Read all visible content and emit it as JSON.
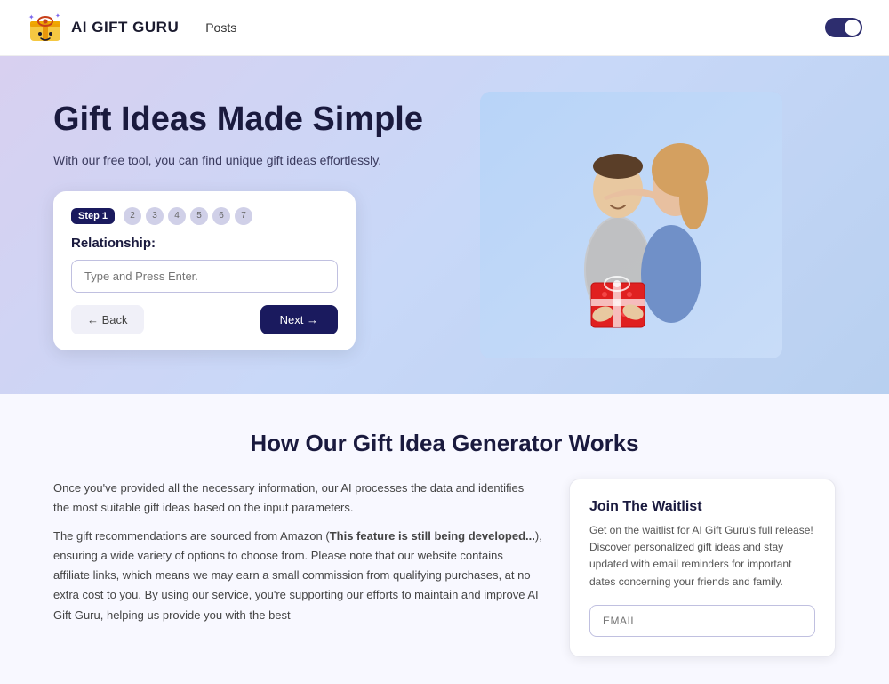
{
  "nav": {
    "logo_text": "AI GIFT GURU",
    "links": [
      {
        "label": "Posts"
      }
    ],
    "toggle_state": "dark"
  },
  "hero": {
    "title": "Gift Ideas Made Simple",
    "subtitle": "With our free tool, you can find unique gift ideas effortlessly.",
    "card": {
      "step_badge": "Step 1",
      "step_numbers": [
        2,
        3,
        4,
        5,
        6,
        7
      ],
      "relationship_label": "Relationship:",
      "input_placeholder": "Type and Press Enter.",
      "btn_back": "← Back",
      "btn_next": "Next →"
    }
  },
  "how_section": {
    "title": "How Our Gift Idea Generator Works",
    "paragraph1": "Once you've provided all the necessary information, our AI processes the data and identifies the most suitable gift ideas based on the input parameters.",
    "paragraph2_start": "The gift recommendations are sourced from Amazon (",
    "paragraph2_bold": "This feature is still being developed...",
    "paragraph2_end": "), ensuring a wide variety of options to choose from. Please note that our website contains affiliate links, which means we may earn a small commission from qualifying purchases, at no extra cost to you. By using our service, you're supporting our efforts to maintain and improve AI Gift Guru, helping us provide you with the best",
    "waitlist": {
      "title": "Join The Waitlist",
      "description": "Get on the waitlist for AI Gift Guru's full release! Discover personalized gift ideas and stay updated with email reminders for important dates concerning your friends and family.",
      "email_placeholder": "EMAIL"
    }
  }
}
